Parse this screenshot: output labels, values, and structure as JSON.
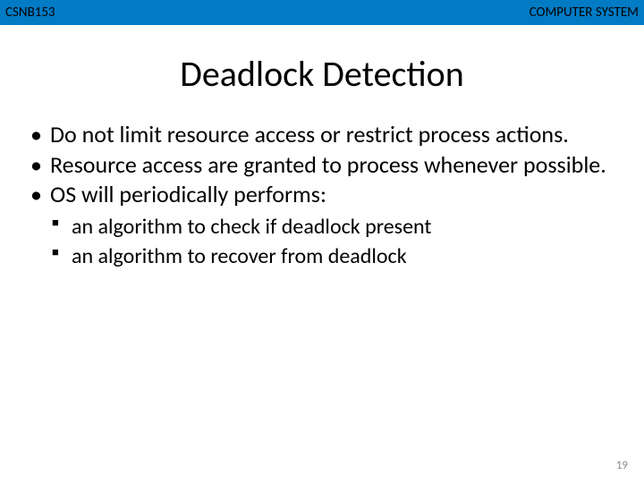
{
  "header": {
    "course_code": "CSNB153",
    "course_name": "COMPUTER SYSTEM"
  },
  "title": "Deadlock Detection",
  "bullets": [
    "Do not limit resource access or restrict process actions.",
    "Resource access are granted to process whenever possible.",
    "OS will periodically performs:"
  ],
  "sub_bullets": [
    "an algorithm to check if deadlock present",
    "an algorithm to recover from deadlock"
  ],
  "page_number": "19"
}
